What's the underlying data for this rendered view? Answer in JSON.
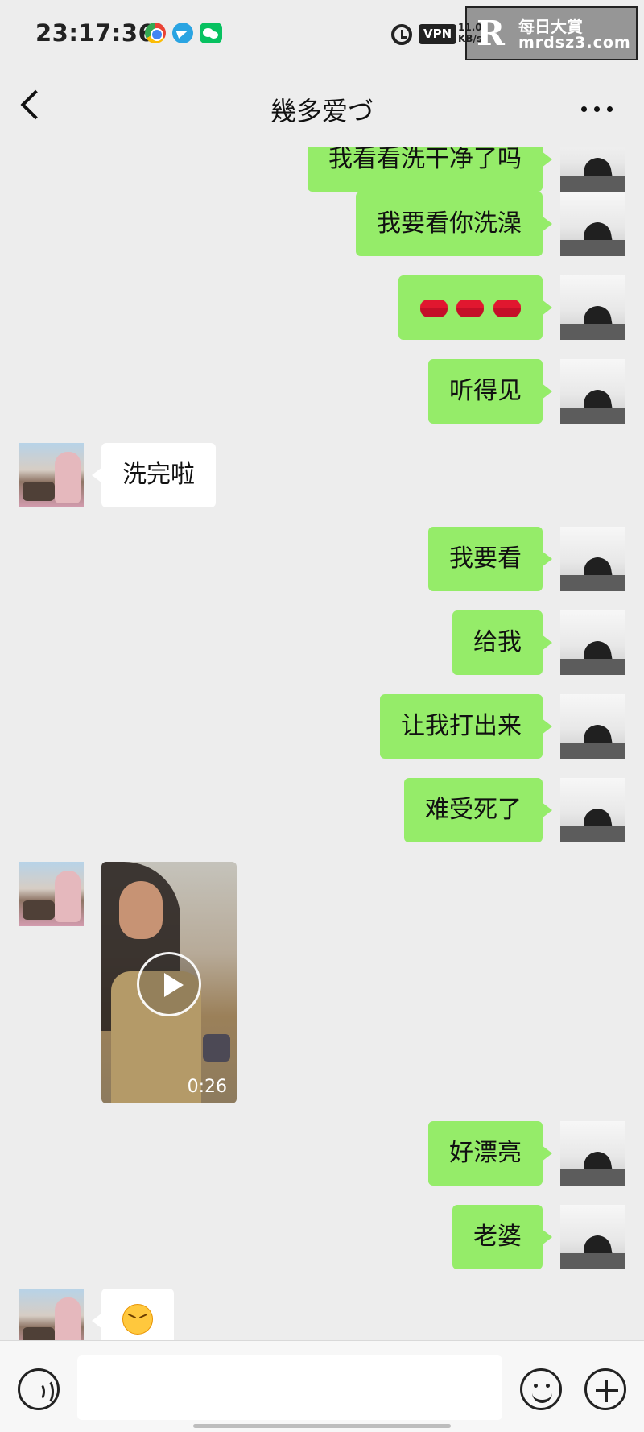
{
  "status_bar": {
    "time": "23:17:36",
    "vpn": "VPN",
    "network_speed": "11.0 KB/s",
    "watermark": {
      "logo": "R",
      "title": "每日大賞",
      "url": "mrdsz3.com"
    }
  },
  "nav": {
    "title": "幾多爱づ",
    "back_icon": "back-icon",
    "more_icon": "more-icon"
  },
  "messages": [
    {
      "sender": "self",
      "text": "我看看洗干净了吗",
      "partially_visible": true
    },
    {
      "sender": "self",
      "text": "我要看你洗澡"
    },
    {
      "sender": "self",
      "emoji": [
        "lips",
        "lips",
        "lips"
      ]
    },
    {
      "sender": "self",
      "text": "听得见"
    },
    {
      "sender": "other",
      "text": "洗完啦"
    },
    {
      "sender": "self",
      "text": "我要看"
    },
    {
      "sender": "self",
      "text": "给我"
    },
    {
      "sender": "self",
      "text": "让我打出来"
    },
    {
      "sender": "self",
      "text": "难受死了"
    },
    {
      "sender": "other",
      "type": "video",
      "duration": "0:26"
    },
    {
      "sender": "self",
      "text": "好漂亮"
    },
    {
      "sender": "self",
      "text": "老婆"
    },
    {
      "sender": "other",
      "emoji": "tired-face"
    }
  ],
  "input_bar": {
    "voice_icon": "voice-icon",
    "emoji_icon": "emoji-icon",
    "plus_icon": "plus-icon"
  },
  "colors": {
    "chat_background": "#ededed",
    "self_bubble": "#95ec69",
    "other_bubble": "#ffffff"
  }
}
